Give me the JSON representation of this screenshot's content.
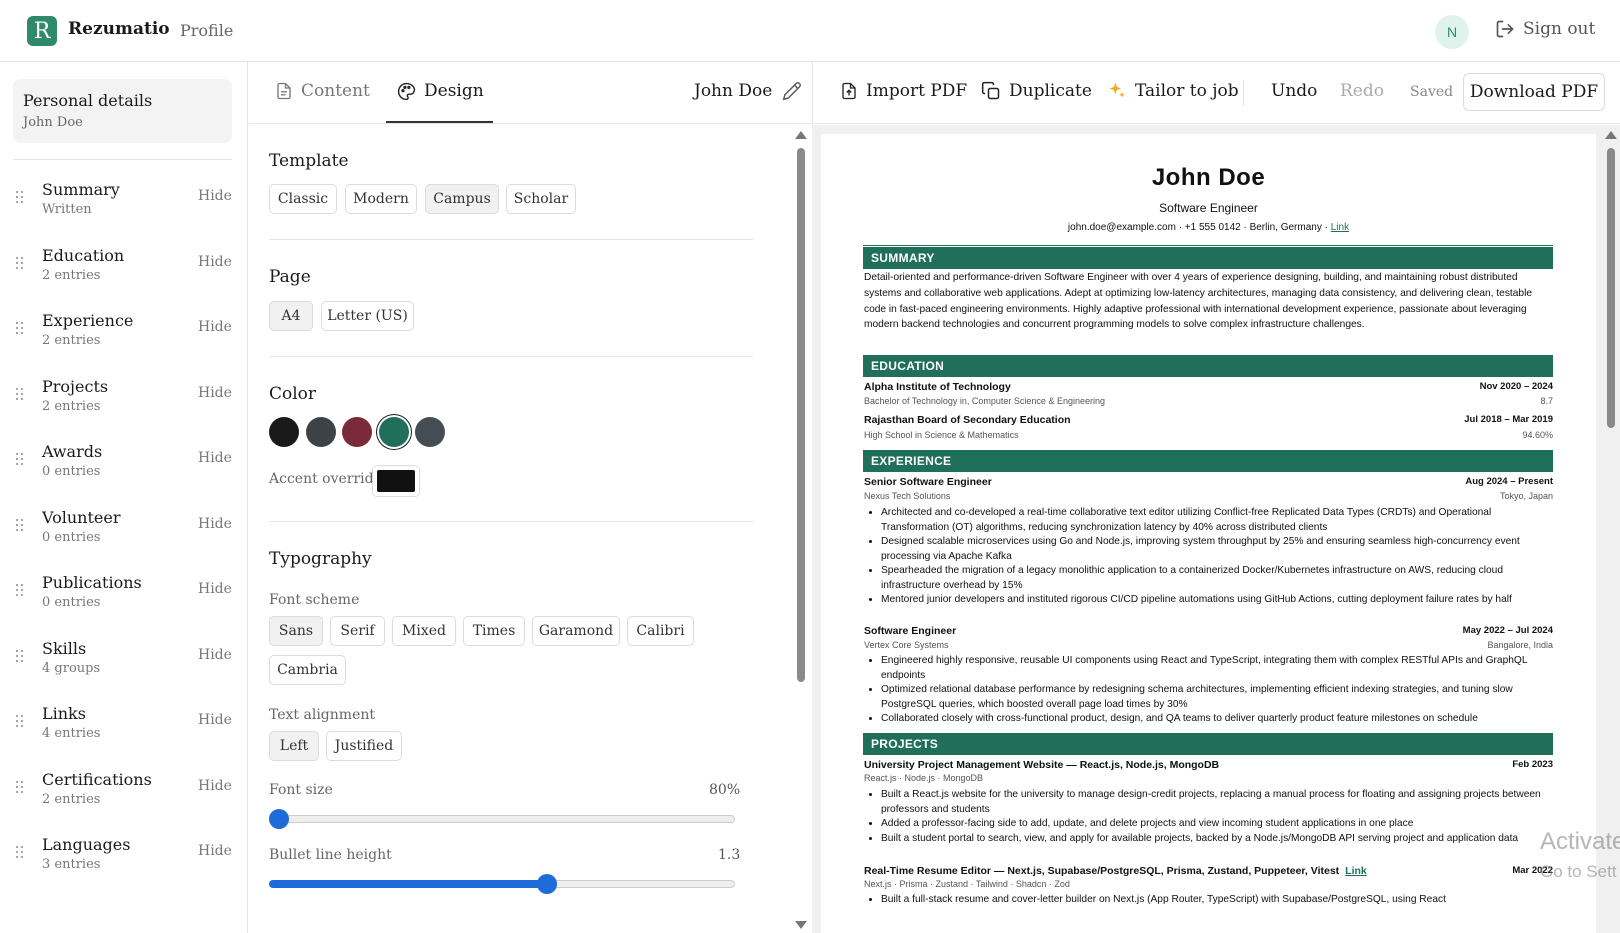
{
  "app": {
    "logo_letter": "R",
    "brand": "Rezumatio",
    "profile": "Profile",
    "avatar_initial": "N",
    "sign_out": "Sign out"
  },
  "sidebar": {
    "personal": {
      "title": "Personal details",
      "subtitle": "John Doe"
    },
    "hide_label": "Hide",
    "sections": [
      {
        "name": "Summary",
        "count": "Written"
      },
      {
        "name": "Education",
        "count": "2 entries"
      },
      {
        "name": "Experience",
        "count": "2 entries"
      },
      {
        "name": "Projects",
        "count": "2 entries"
      },
      {
        "name": "Awards",
        "count": "0 entries"
      },
      {
        "name": "Volunteer",
        "count": "0 entries"
      },
      {
        "name": "Publications",
        "count": "0 entries"
      },
      {
        "name": "Skills",
        "count": "4 groups"
      },
      {
        "name": "Links",
        "count": "4 entries"
      },
      {
        "name": "Certifications",
        "count": "2 entries"
      },
      {
        "name": "Languages",
        "count": "3 entries"
      }
    ]
  },
  "editor": {
    "tabs": {
      "content": "Content",
      "design": "Design",
      "active": "design"
    },
    "doc_name": "John Doe",
    "template": {
      "label": "Template",
      "options": [
        "Classic",
        "Modern",
        "Campus",
        "Scholar"
      ],
      "selected": "Campus"
    },
    "page": {
      "label": "Page",
      "options": [
        "A4",
        "Letter (US)"
      ],
      "selected": "A4"
    },
    "color": {
      "label": "Color",
      "swatches": [
        "#1a1a1a",
        "#3d4247",
        "#7a2a3a",
        "#1f6f5a",
        "#454c52"
      ],
      "selected": "#1f6f5a",
      "accent_label": "Accent override",
      "accent_value": "#111111"
    },
    "typography": {
      "label": "Typography",
      "font_scheme_label": "Font scheme",
      "font_schemes": [
        "Sans",
        "Serif",
        "Mixed",
        "Times",
        "Garamond",
        "Calibri",
        "Cambria"
      ],
      "font_scheme_selected": "Sans",
      "alignment_label": "Text alignment",
      "alignments": [
        "Left",
        "Justified"
      ],
      "alignment_selected": "Left",
      "font_size_label": "Font size",
      "font_size_value": "80%",
      "font_size_fraction": 0.0,
      "bullet_label": "Bullet line height",
      "bullet_value": "1.3",
      "bullet_fraction": 0.6
    }
  },
  "toolbar": {
    "import": "Import PDF",
    "duplicate": "Duplicate",
    "tailor": "Tailor to job",
    "undo": "Undo",
    "redo": "Redo",
    "saved": "Saved",
    "download": "Download PDF"
  },
  "resume": {
    "name": "John Doe",
    "title": "Software Engineer",
    "contact": "john.doe@example.com · +1 555 0142 · Berlin, Germany · ",
    "contact_link": "Link",
    "headings": {
      "summary": "SUMMARY",
      "education": "EDUCATION",
      "experience": "EXPERIENCE",
      "projects": "PROJECTS"
    },
    "summary": "Detail-oriented and performance-driven Software Engineer with over 4 years of experience designing, building, and maintaining robust distributed systems and collaborative web applications. Adept at optimizing low-latency architectures, managing data consistency, and delivering clean, testable code in fast-paced engineering environments. Highly adaptive professional with international development experience, passionate about leveraging modern backend technologies and concurrent programming models to solve complex infrastructure challenges.",
    "education": [
      {
        "school": "Alpha Institute of Technology",
        "dates": "Nov 2020 – 2024",
        "degree": "Bachelor of Technology in, Computer Science & Engineering",
        "score": "8.7"
      },
      {
        "school": "Rajasthan Board of Secondary Education",
        "dates": "Jul 2018 – Mar 2019",
        "degree": "High School in Science & Mathematics",
        "score": "94.60%"
      }
    ],
    "experience": [
      {
        "role": "Senior Software Engineer",
        "dates": "Aug 2024 – Present",
        "company": "Nexus Tech Solutions",
        "location": "Tokyo, Japan",
        "bullets": [
          "Architected and co-developed a real-time collaborative text editor utilizing Conflict-free Replicated Data Types (CRDTs) and Operational Transformation (OT) algorithms, reducing synchronization latency by 40% across distributed clients",
          "Designed scalable microservices using Go and Node.js, improving system throughput by 25% and ensuring seamless high-concurrency event processing via Apache Kafka",
          "Spearheaded the migration of a legacy monolithic application to a containerized Docker/Kubernetes infrastructure on AWS, reducing cloud infrastructure overhead by 15%",
          "Mentored junior developers and instituted rigorous CI/CD pipeline automations using GitHub Actions, cutting deployment failure rates by half"
        ]
      },
      {
        "role": "Software Engineer",
        "dates": "May 2022 – Jul 2024",
        "company": "Vertex Core Systems",
        "location": "Bangalore, India",
        "bullets": [
          "Engineered highly responsive, reusable UI components using React and TypeScript, integrating them with complex RESTful APIs and GraphQL endpoints",
          "Optimized relational database performance by redesigning schema architectures, implementing efficient indexing strategies, and tuning slow PostgreSQL queries, which boosted overall page load times by 30%",
          "Collaborated closely with cross-functional product, design, and QA teams to deliver quarterly product feature milestones on schedule"
        ]
      }
    ],
    "projects": [
      {
        "name": "University Project Management Website — React.js, Node.js, MongoDB",
        "date": "Feb 2023",
        "stack": "React.js · Node.js · MongoDB",
        "bullets": [
          "Built a React.js website for the university to manage design-credit projects, replacing a manual process for floating and assigning projects between professors and students",
          "Added a professor-facing side to add, update, and delete projects and view incoming student applications in one place",
          "Built a student portal to search, view, and apply for available projects, backed by a Node.js/MongoDB API serving project and application data"
        ]
      },
      {
        "name": "Real-Time Resume Editor — Next.js, Supabase/PostgreSQL, Prisma, Zustand, Puppeteer, Vitest",
        "link": "Link",
        "date": "Mar 2022",
        "stack": "Next.js · Prisma · Zustand · Tailwind · Shadcn · Zod",
        "bullets": [
          "Built a full-stack resume and cover-letter builder on Next.js (App Router, TypeScript) with Supabase/PostgreSQL, using React"
        ]
      }
    ]
  },
  "watermark": {
    "line1": "Activate",
    "line2": "Go to Sett"
  }
}
